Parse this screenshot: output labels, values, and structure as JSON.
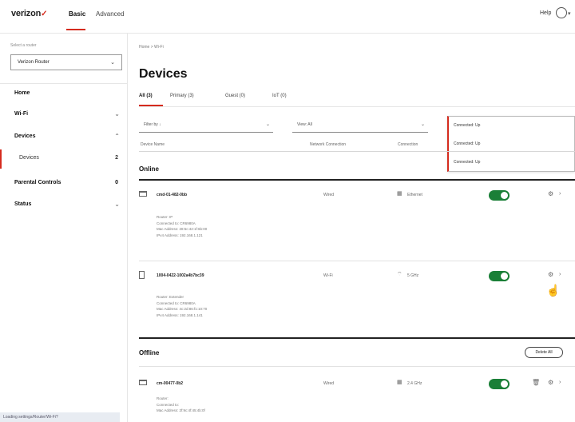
{
  "header": {
    "brand": "verizon",
    "tabs": [
      {
        "label": "Basic",
        "active": true
      },
      {
        "label": "Advanced",
        "active": false
      }
    ],
    "help_label": "Help",
    "accent_color": "#d52b1e"
  },
  "sidebar": {
    "section_label": "Select a router",
    "router_value": "Verizon Router",
    "items": [
      {
        "label": "Home"
      },
      {
        "label": "Wi-Fi"
      },
      {
        "label": "Devices"
      },
      {
        "label": "Devices",
        "count": "2",
        "active": true
      },
      {
        "label": "Parental Controls",
        "count": "0"
      },
      {
        "label": "Status"
      }
    ],
    "footer_text": "Loading settings/Router/Wi-Fi?"
  },
  "main": {
    "breadcrumb": "Home > Wi-Fi",
    "title": "Devices",
    "tabs": [
      {
        "label": "All (3)",
        "active": true
      },
      {
        "label": "Primary (3)",
        "active": false
      },
      {
        "label": "Guest (0)",
        "active": false
      },
      {
        "label": "IoT (0)",
        "active": false
      }
    ],
    "filters": {
      "filter_by_label": "Filter by ↓",
      "view_label": "View: All",
      "sort_value": "Connected: Up",
      "sort_options": [
        "Connected: Up",
        "Connected: Up"
      ]
    },
    "columns": [
      "Device Name",
      "Network Connection",
      "Connection"
    ],
    "online_title": "Online",
    "offline_title": "Offline",
    "delete_all_label": "Delete All",
    "devices_online": [
      {
        "name": "cmd-01-482-0bb",
        "type": "Wired",
        "connection": "Ethernet",
        "enabled": true,
        "details": [
          "Router: IP",
          "Connected to: CR6980A",
          "Mac Address: 28:5c:42:1f:6b:00",
          "IPv4 Address: 192.168.1.121"
        ]
      },
      {
        "name": "1004-0422-1002a4b7bc39",
        "type": "Wi-Fi",
        "connection": "5 GHz",
        "enabled": true,
        "details": [
          "Router: Extender",
          "Connected to: CR6980A",
          "Mac Address: 4c:2d:86:f1:10:70",
          "IPv4 Address: 192.168.1.141"
        ]
      }
    ],
    "devices_offline": [
      {
        "name": "cm-00477-0b2",
        "type": "Wired",
        "connection": "2.4 GHz",
        "enabled": true,
        "details": [
          "Router:",
          "Connected to:",
          "Mac Address: 2f:9c:4f:45:4b:0f"
        ]
      }
    ]
  }
}
